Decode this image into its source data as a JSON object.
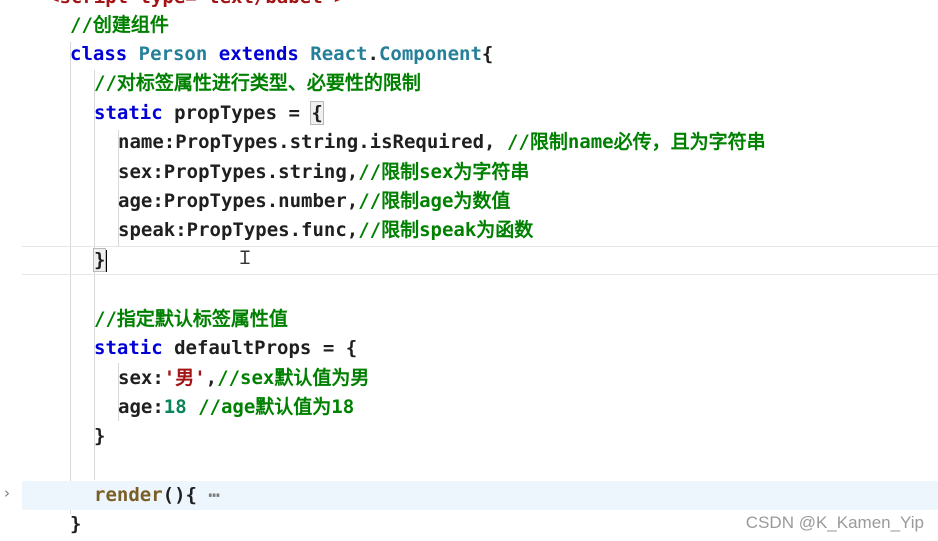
{
  "editor": {
    "top_clipped_line": "<script type=\"text/babel\">",
    "lines": {
      "l1_comment": "//创建组件",
      "l2_class": "class",
      "l2_name": "Person",
      "l2_extends": "extends",
      "l2_react": "React",
      "l2_dot": ".",
      "l2_component": "Component",
      "l2_brace": "{",
      "l3_comment": "//对标签属性进行类型、必要性的限制",
      "l4_static": "static",
      "l4_name": "propTypes",
      "l4_eq": " = ",
      "l4_brace": "{",
      "l5_key": "name",
      "l5_val": ":PropTypes.string.isRequired, ",
      "l5_comment": "//限制name必传，且为字符串",
      "l6_key": "sex",
      "l6_val": ":PropTypes.string,",
      "l6_comment": "//限制sex为字符串",
      "l7_key": "age",
      "l7_val": ":PropTypes.number,",
      "l7_comment": "//限制age为数值",
      "l8_key": "speak",
      "l8_val": ":PropTypes.func,",
      "l8_comment": "//限制speak为函数",
      "l9_brace": "}",
      "l11_comment": "//指定默认标签属性值",
      "l12_static": "static",
      "l12_name": "defaultProps",
      "l12_eq": " = ",
      "l12_brace": "{",
      "l13_key": "sex",
      "l13_colon": ":",
      "l13_str": "'男'",
      "l13_comma": ",",
      "l13_comment": "//sex默认值为男",
      "l14_key": "age",
      "l14_colon": ":",
      "l14_num": "18",
      "l14_comment": " //age默认值为18",
      "l15_brace": "}",
      "l17_method": "render",
      "l17_parens": "(){",
      "l17_ellipsis": " ⋯",
      "l18_brace": "}"
    },
    "fold_icon": "chevron-right-icon"
  },
  "watermark": "CSDN @K_Kamen_Yip",
  "colors": {
    "keyword": "#0000d6",
    "class_name": "#267f99",
    "comment": "#008000",
    "string": "#a31515",
    "number": "#098658",
    "method": "#795e26",
    "highlight": "#eef6fd"
  }
}
